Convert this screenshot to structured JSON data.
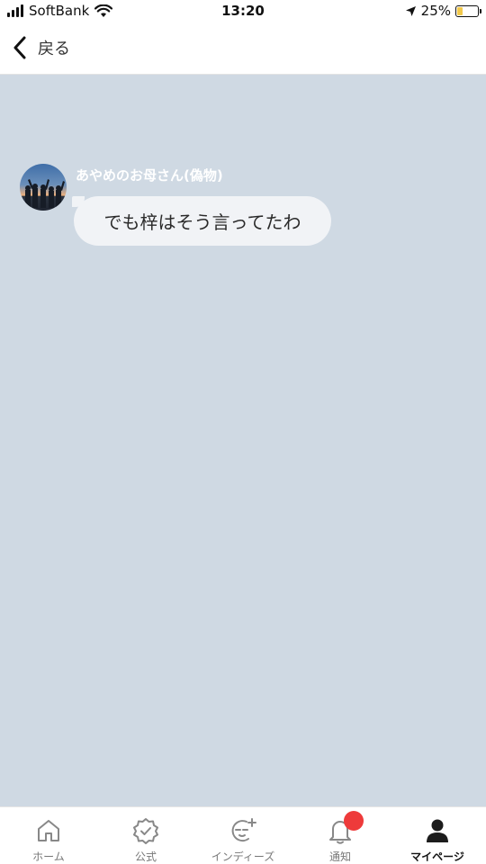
{
  "status_bar": {
    "carrier": "SoftBank",
    "time": "13:20",
    "battery": "25%",
    "battery_level": 0.25,
    "icons": [
      "signal-icon",
      "wifi-icon",
      "location-arrow-icon",
      "battery-charging-icon"
    ]
  },
  "header": {
    "back_label": "戻る",
    "back_icon": "chevron-left-icon"
  },
  "chat": {
    "messages": [
      {
        "sender": "あやめのお母さん(偽物)",
        "text": "でも梓はそう言ってたわ",
        "avatar": "group-photo-avatar"
      }
    ]
  },
  "tab_bar": {
    "tabs": [
      {
        "label": "ホーム",
        "icon": "home-icon"
      },
      {
        "label": "公式",
        "icon": "verified-badge-icon"
      },
      {
        "label": "インディーズ",
        "icon": "indies-face-icon"
      },
      {
        "label": "通知",
        "icon": "bell-icon"
      },
      {
        "label": "マイページ",
        "icon": "user-icon"
      }
    ],
    "active_tab": "マイページ"
  },
  "colors": {
    "chat_background": "#cfd9e3",
    "bubble": "#f1f3f6",
    "badge": "#ee3a3a",
    "battery_charging": "#f2c94c"
  }
}
